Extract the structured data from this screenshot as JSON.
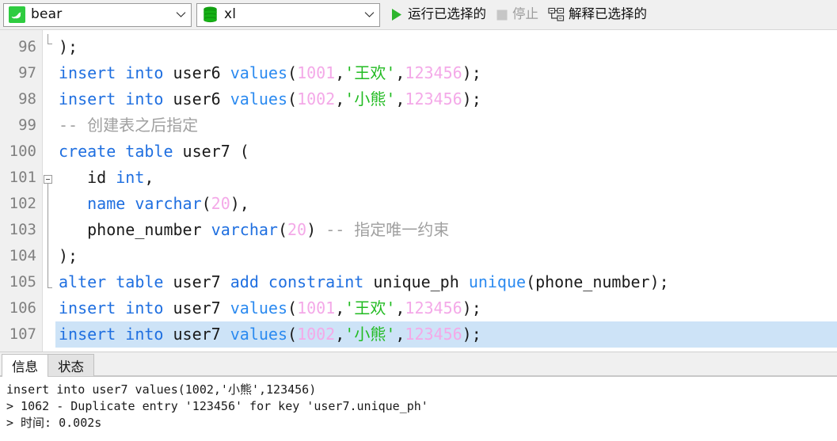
{
  "toolbar": {
    "connection": {
      "icon": "mysql-dolphin-icon",
      "value": "bear",
      "chevron": "chevron-down-icon"
    },
    "database": {
      "icon": "database-icon",
      "value": "xl",
      "chevron": "chevron-down-icon"
    },
    "run_selected": {
      "icon": "play-icon",
      "label": "运行已选择的",
      "enabled": true
    },
    "stop": {
      "icon": "stop-icon",
      "label": "停止",
      "enabled": false
    },
    "explain_selected": {
      "icon": "explain-plan-icon",
      "label": "解释已选择的",
      "enabled": true
    }
  },
  "editor": {
    "first_line": 96,
    "colors": {
      "keyword": "#1f6fe0",
      "number": "#f4a9e8",
      "string": "#22bb22",
      "comment": "#a0a0a0",
      "selection": "#cde3f7",
      "gutter_bg": "#f0f0f0",
      "line_number": "#808080"
    },
    "lines": [
      {
        "n": "96",
        "text": ");"
      },
      {
        "n": "97",
        "text": "insert into user6 values(1001,'王欢',123456);"
      },
      {
        "n": "98",
        "text": "insert into user6 values(1002,'小熊',123456);"
      },
      {
        "n": "99",
        "text": "-- 创建表之后指定"
      },
      {
        "n": "100",
        "text": "create table user7 ("
      },
      {
        "n": "101",
        "text": "    id int,"
      },
      {
        "n": "102",
        "text": "    name varchar(20),"
      },
      {
        "n": "103",
        "text": "    phone_number varchar(20) -- 指定唯一约束"
      },
      {
        "n": "104",
        "text": ");"
      },
      {
        "n": "105",
        "text": "alter table user7 add constraint unique_ph unique(phone_number);"
      },
      {
        "n": "106",
        "text": "insert into user7 values(1001,'王欢',123456);"
      },
      {
        "n": "107",
        "text": "insert into user7 values(1002,'小熊',123456);",
        "selected": true
      }
    ]
  },
  "results": {
    "tabs": [
      {
        "label": "信息",
        "active": true
      },
      {
        "label": "状态",
        "active": false
      }
    ],
    "log": [
      "insert into user7 values(1002,'小熊',123456)",
      "> 1062 - Duplicate entry '123456' for key 'user7.unique_ph'",
      "> 时间: 0.002s"
    ]
  }
}
